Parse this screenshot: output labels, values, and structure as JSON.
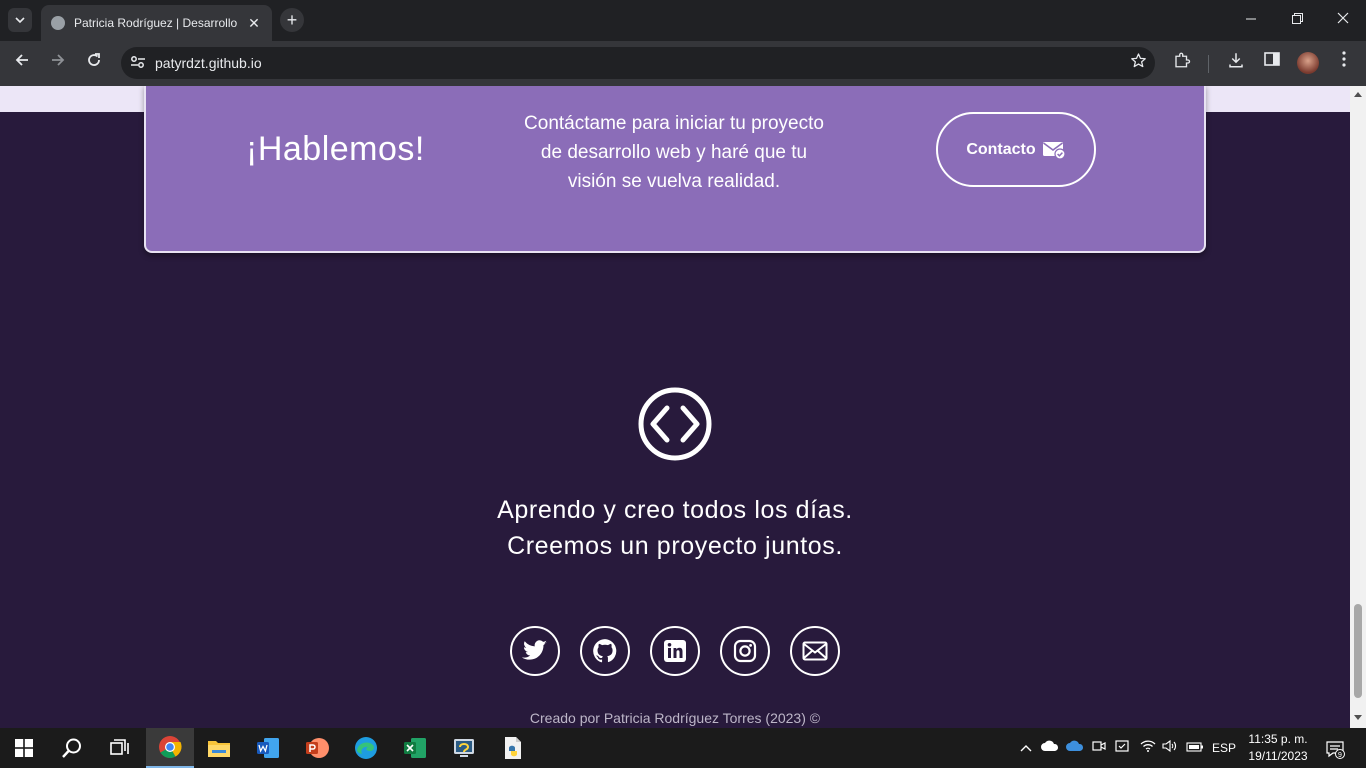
{
  "browser": {
    "tab_title": "Patricia Rodríguez | Desarrollo",
    "url": "patyrdzt.github.io",
    "new_tab": "+",
    "tab_close": "✕"
  },
  "cta": {
    "heading": "¡Hablemos!",
    "text": "Contáctame para iniciar tu proyecto de desarrollo web y haré que tu visión se vuelva realidad.",
    "button_label": "Contacto"
  },
  "footer": {
    "tagline_1": "Aprendo y creo todos los días.",
    "tagline_2": "Creemos un proyecto juntos.",
    "social": [
      "twitter-icon",
      "github-icon",
      "linkedin-icon",
      "instagram-icon",
      "mail-icon"
    ],
    "credit": "Creado por Patricia Rodríguez Torres (2023) ©"
  },
  "taskbar": {
    "language": "ESP",
    "time": "11:35 p. m.",
    "date": "19/11/2023",
    "notifications": "9"
  },
  "colors": {
    "page_bg": "#281a3c",
    "cta_bg": "#8b6db8",
    "strip": "#ece6f7"
  }
}
